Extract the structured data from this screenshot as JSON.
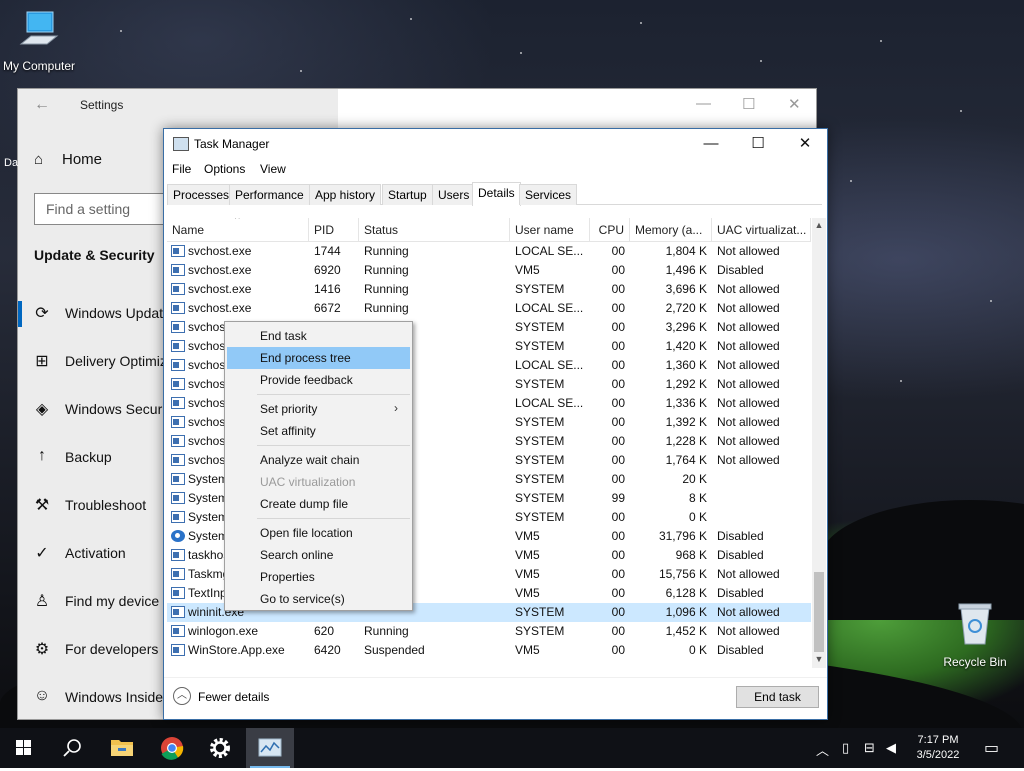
{
  "desktop": {
    "icons": [
      {
        "label": "My Computer"
      },
      {
        "label": "Recycle Bin"
      }
    ],
    "partial_label": "Da"
  },
  "settings": {
    "title": "Settings",
    "home": "Home",
    "search_placeholder": "Find a setting",
    "section": "Update & Security",
    "nav": [
      {
        "label": "Windows Update",
        "icon": "refresh-icon"
      },
      {
        "label": "Delivery Optimization",
        "icon": "delivery-icon"
      },
      {
        "label": "Windows Security",
        "icon": "shield-icon"
      },
      {
        "label": "Backup",
        "icon": "upload-arrow-icon"
      },
      {
        "label": "Troubleshoot",
        "icon": "wrench-icon"
      },
      {
        "label": "Activation",
        "icon": "check-circle-icon"
      },
      {
        "label": "Find my device",
        "icon": "person-pin-icon"
      },
      {
        "label": "For developers",
        "icon": "developer-icon"
      },
      {
        "label": "Windows Insider Program",
        "icon": "insider-cat-icon"
      }
    ]
  },
  "taskmanager": {
    "title": "Task Manager",
    "menu": [
      "File",
      "Options",
      "View"
    ],
    "tabs": [
      "Processes",
      "Performance",
      "App history",
      "Startup",
      "Users",
      "Details",
      "Services"
    ],
    "active_tab": "Details",
    "columns": [
      "Name",
      "PID",
      "Status",
      "User name",
      "CPU",
      "Memory (a...",
      "UAC virtualizat..."
    ],
    "rows": [
      {
        "name": "svchost.exe",
        "pid": "1744",
        "status": "Running",
        "user": "LOCAL SE...",
        "cpu": "00",
        "mem": "1,804 K",
        "uac": "Not allowed"
      },
      {
        "name": "svchost.exe",
        "pid": "6920",
        "status": "Running",
        "user": "VM5",
        "cpu": "00",
        "mem": "1,496 K",
        "uac": "Disabled"
      },
      {
        "name": "svchost.exe",
        "pid": "1416",
        "status": "Running",
        "user": "SYSTEM",
        "cpu": "00",
        "mem": "3,696 K",
        "uac": "Not allowed"
      },
      {
        "name": "svchost.exe",
        "pid": "6672",
        "status": "Running",
        "user": "LOCAL SE...",
        "cpu": "00",
        "mem": "2,720 K",
        "uac": "Not allowed"
      },
      {
        "name": "svchost",
        "pid": "",
        "status": "",
        "user": "SYSTEM",
        "cpu": "00",
        "mem": "3,296 K",
        "uac": "Not allowed"
      },
      {
        "name": "svchost",
        "pid": "",
        "status": "",
        "user": "SYSTEM",
        "cpu": "00",
        "mem": "1,420 K",
        "uac": "Not allowed"
      },
      {
        "name": "svchost",
        "pid": "",
        "status": "",
        "user": "LOCAL SE...",
        "cpu": "00",
        "mem": "1,360 K",
        "uac": "Not allowed"
      },
      {
        "name": "svchost",
        "pid": "",
        "status": "",
        "user": "SYSTEM",
        "cpu": "00",
        "mem": "1,292 K",
        "uac": "Not allowed"
      },
      {
        "name": "svchost",
        "pid": "",
        "status": "",
        "user": "LOCAL SE...",
        "cpu": "00",
        "mem": "1,336 K",
        "uac": "Not allowed"
      },
      {
        "name": "svchost",
        "pid": "",
        "status": "",
        "user": "SYSTEM",
        "cpu": "00",
        "mem": "1,392 K",
        "uac": "Not allowed"
      },
      {
        "name": "svchost",
        "pid": "",
        "status": "",
        "user": "SYSTEM",
        "cpu": "00",
        "mem": "1,228 K",
        "uac": "Not allowed"
      },
      {
        "name": "svchost",
        "pid": "",
        "status": "",
        "user": "SYSTEM",
        "cpu": "00",
        "mem": "1,764 K",
        "uac": "Not allowed"
      },
      {
        "name": "System",
        "pid": "",
        "status": "",
        "user": "SYSTEM",
        "cpu": "00",
        "mem": "20 K",
        "uac": ""
      },
      {
        "name": "System",
        "pid": "",
        "status": "",
        "user": "SYSTEM",
        "cpu": "99",
        "mem": "8 K",
        "uac": ""
      },
      {
        "name": "System",
        "pid": "",
        "status": "",
        "user": "SYSTEM",
        "cpu": "00",
        "mem": "0 K",
        "uac": ""
      },
      {
        "name": "System",
        "pid": "",
        "status": "",
        "user": "VM5",
        "cpu": "00",
        "mem": "31,796 K",
        "uac": "Disabled"
      },
      {
        "name": "taskhos",
        "pid": "",
        "status": "",
        "user": "VM5",
        "cpu": "00",
        "mem": "968 K",
        "uac": "Disabled"
      },
      {
        "name": "Taskmg",
        "pid": "",
        "status": "",
        "user": "VM5",
        "cpu": "00",
        "mem": "15,756 K",
        "uac": "Not allowed"
      },
      {
        "name": "TextInp",
        "pid": "",
        "status": "",
        "user": "VM5",
        "cpu": "00",
        "mem": "6,128 K",
        "uac": "Disabled"
      },
      {
        "name": "wininit.exe",
        "pid": "",
        "status": "",
        "user": "SYSTEM",
        "cpu": "00",
        "mem": "1,096 K",
        "uac": "Not allowed"
      },
      {
        "name": "winlogon.exe",
        "pid": "620",
        "status": "Running",
        "user": "SYSTEM",
        "cpu": "00",
        "mem": "1,452 K",
        "uac": "Not allowed"
      },
      {
        "name": "WinStore.App.exe",
        "pid": "6420",
        "status": "Suspended",
        "user": "VM5",
        "cpu": "00",
        "mem": "0 K",
        "uac": "Disabled"
      }
    ],
    "selected_row": 19,
    "fewer_details": "Fewer details",
    "end_task": "End task"
  },
  "context_menu": {
    "items": [
      {
        "label": "End task",
        "state": "normal"
      },
      {
        "label": "End process tree",
        "state": "highlighted"
      },
      {
        "label": "Provide feedback",
        "state": "normal"
      },
      {
        "label": "Set priority",
        "state": "submenu"
      },
      {
        "label": "Set affinity",
        "state": "normal"
      },
      {
        "label": "Analyze wait chain",
        "state": "normal"
      },
      {
        "label": "UAC virtualization",
        "state": "disabled"
      },
      {
        "label": "Create dump file",
        "state": "normal"
      },
      {
        "label": "Open file location",
        "state": "normal"
      },
      {
        "label": "Search online",
        "state": "normal"
      },
      {
        "label": "Properties",
        "state": "normal"
      },
      {
        "label": "Go to service(s)",
        "state": "normal"
      }
    ],
    "submenu_glyph": "›"
  },
  "taskbar": {
    "apps": [
      {
        "name": "start-button",
        "icon": "windows-logo-icon"
      },
      {
        "name": "search-button",
        "icon": "search-icon"
      },
      {
        "name": "file-explorer",
        "icon": "folder-icon"
      },
      {
        "name": "chrome",
        "icon": "chrome-icon"
      },
      {
        "name": "settings-app",
        "icon": "gear-icon"
      },
      {
        "name": "task-manager-app",
        "icon": "task-manager-icon"
      }
    ],
    "time": "7:17 PM",
    "date": "3/5/2022"
  },
  "colors": {
    "selection": "#cce8ff",
    "menu_highlight": "#91c9f7",
    "accent": "#0067c0"
  }
}
